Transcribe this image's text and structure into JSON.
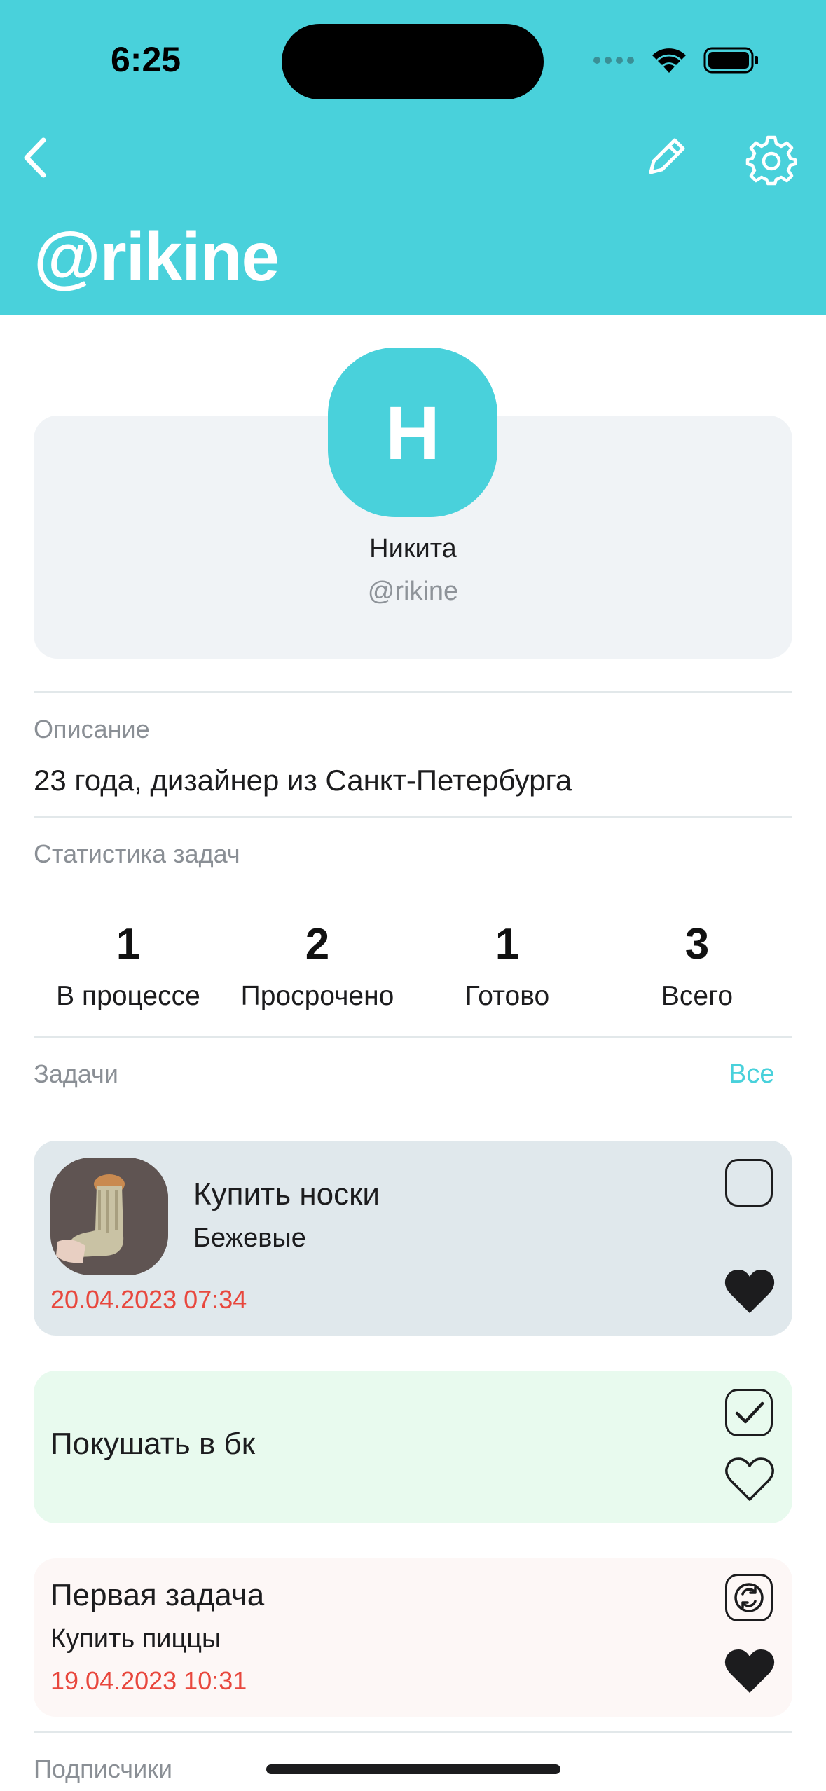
{
  "status_bar": {
    "time": "6:25"
  },
  "header": {
    "title": "@rikine"
  },
  "profile": {
    "avatar_letter": "Н",
    "name": "Никита",
    "handle": "@rikine"
  },
  "description": {
    "label": "Описание",
    "text": "23 года, дизайнер из Санкт-Петербурга"
  },
  "stats": {
    "label": "Статистика задач",
    "items": [
      {
        "value": "1",
        "label": "В процессе"
      },
      {
        "value": "2",
        "label": "Просрочено"
      },
      {
        "value": "1",
        "label": "Готово"
      },
      {
        "value": "3",
        "label": "Всего"
      }
    ]
  },
  "tasks": {
    "label": "Задачи",
    "see_all": "Все",
    "items": [
      {
        "title": "Купить носки",
        "subtitle": "Бежевые",
        "date": "20.04.2023 07:34",
        "checkbox": "empty",
        "favorite": true,
        "background": "#e0e8ec"
      },
      {
        "title": "Покушать в бк",
        "checkbox": "checked",
        "favorite": false,
        "background": "#e8faee"
      },
      {
        "title": "Первая задача",
        "subtitle": "Купить пиццы",
        "date": "19.04.2023 10:31",
        "checkbox": "repeat",
        "favorite": true,
        "background": "#fdf7f6"
      }
    ]
  },
  "followers": {
    "label": "Подписчики"
  },
  "colors": {
    "accent": "#49d1db",
    "overdue": "#e8473d"
  }
}
